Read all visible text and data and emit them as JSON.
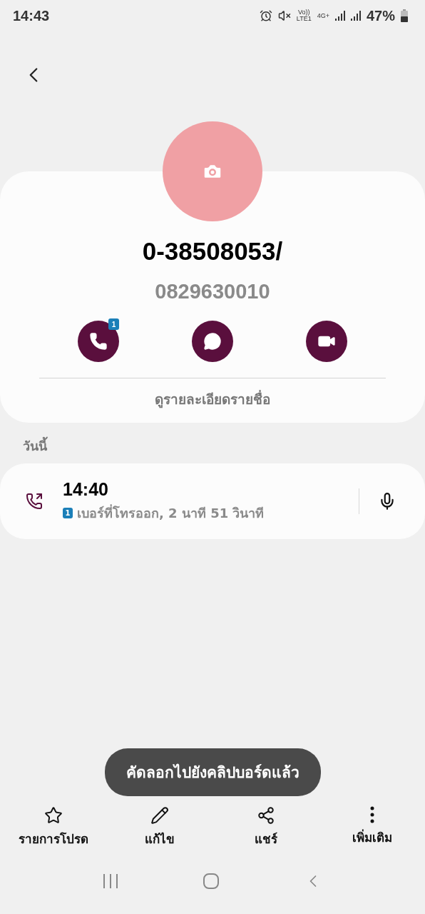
{
  "status_bar": {
    "time": "14:43",
    "volte": "Vo))",
    "lte": "LTE1",
    "network": "4G+",
    "battery": "47%"
  },
  "contact": {
    "name": "0-38508053/",
    "number": "0829630010"
  },
  "quick_actions": [
    {
      "kind": "call",
      "badge": "1"
    },
    {
      "kind": "message"
    },
    {
      "kind": "video"
    }
  ],
  "details_link": "ดูรายละเอียดรายชื่อ",
  "section_title": "วันนี้",
  "call_log": [
    {
      "time": "14:40",
      "sim": "1",
      "detail": "เบอร์ที่โทรออก, 2 นาที 51 วินาที"
    }
  ],
  "toast": "คัดลอกไปยังคลิปบอร์ดแล้ว",
  "bottom_actions": [
    {
      "kind": "favorite",
      "label": "รายการโปรด"
    },
    {
      "kind": "edit",
      "label": "แก้ไข"
    },
    {
      "kind": "share",
      "label": "แชร์"
    },
    {
      "kind": "more",
      "label": "เพิ่มเติม"
    }
  ]
}
